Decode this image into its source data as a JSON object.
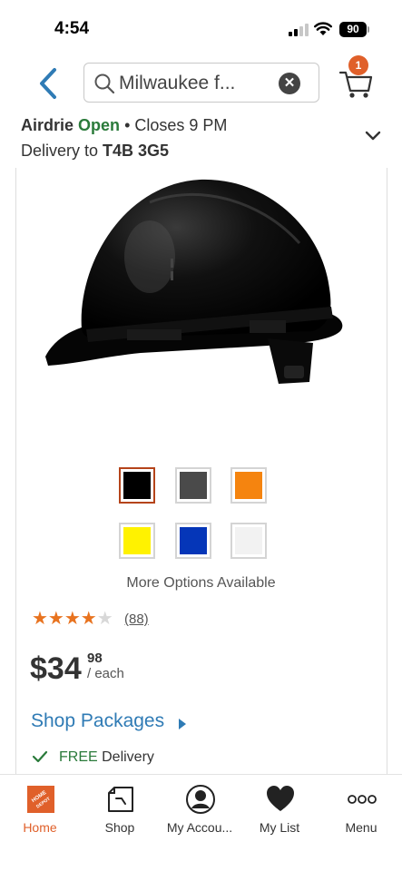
{
  "status_bar": {
    "time": "4:54",
    "battery": "90"
  },
  "header": {
    "search_value": "Milwaukee f...",
    "clear_label": "✕",
    "cart_count": "1"
  },
  "store": {
    "name": "Airdrie",
    "status": "Open",
    "hours": " • Closes 9 PM",
    "delivery_prefix": "Delivery to ",
    "postal_code": "T4B 3G5"
  },
  "product": {
    "swatches": [
      {
        "color": "#000000",
        "selected": true
      },
      {
        "color": "#4a4a4a",
        "selected": false
      },
      {
        "color": "#f5840f",
        "selected": false
      },
      {
        "color": "#fff200",
        "selected": false
      },
      {
        "color": "#0536b8",
        "selected": false
      },
      {
        "color": "#f2f2f2",
        "selected": false
      }
    ],
    "more_options": "More Options Available",
    "rating": 4.5,
    "review_count": "(88)",
    "price_dollars": "$34",
    "price_cents": "98",
    "price_unit": "/ each",
    "shop_packages": "Shop Packages",
    "free_label": "FREE",
    "delivery_label": " Delivery"
  },
  "bottom_nav": {
    "items": [
      {
        "label": "Home",
        "icon": "home-depot-logo-icon",
        "active": true
      },
      {
        "label": "Shop",
        "icon": "shop-icon",
        "active": false
      },
      {
        "label": "My Accou...",
        "icon": "account-icon",
        "active": false
      },
      {
        "label": "My List",
        "icon": "heart-icon",
        "active": false
      },
      {
        "label": "Menu",
        "icon": "menu-dots-icon",
        "active": false
      }
    ],
    "logo_text": "THE HOME DEPOT"
  }
}
